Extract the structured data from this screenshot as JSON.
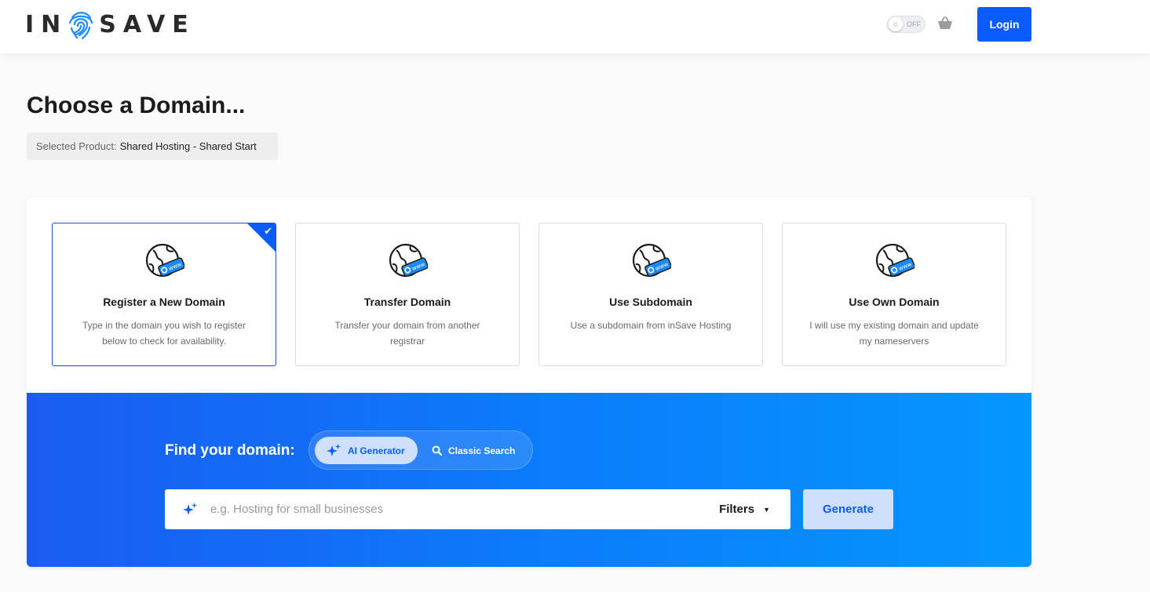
{
  "header": {
    "logo_text_left": "IN",
    "logo_text_right": "SAVE",
    "theme_toggle_label": "OFF",
    "login_label": "Login"
  },
  "page": {
    "title": "Choose a Domain...",
    "selected_product_label": "Selected Product:",
    "selected_product_value": "Shared Hosting - Shared Start"
  },
  "options": [
    {
      "title": "Register a New Domain",
      "description": "Type in the domain you wish to register below to check for availability.",
      "selected": true
    },
    {
      "title": "Transfer Domain",
      "description": "Transfer your domain from another registrar",
      "selected": false
    },
    {
      "title": "Use Subdomain",
      "description": "Use a subdomain from inSave Hosting",
      "selected": false
    },
    {
      "title": "Use Own Domain",
      "description": "I will use my existing domain and update my nameservers",
      "selected": false
    }
  ],
  "search": {
    "find_label": "Find your domain:",
    "mode_ai_label": "AI Generator",
    "mode_classic_label": "Classic Search",
    "active_mode": "AI Generator",
    "placeholder": "e.g. Hosting for small businesses",
    "filters_label": "Filters",
    "generate_label": "Generate"
  },
  "colors": {
    "accent": "#0a5cff",
    "band_start": "#1a5cf2",
    "band_end": "#0596ff"
  },
  "icons": [
    "fingerprint-logo-icon",
    "sun-icon",
    "cart-icon",
    "globe-www-icon",
    "checkmark-icon",
    "sparkle-icon",
    "search-icon",
    "caret-down-icon"
  ]
}
